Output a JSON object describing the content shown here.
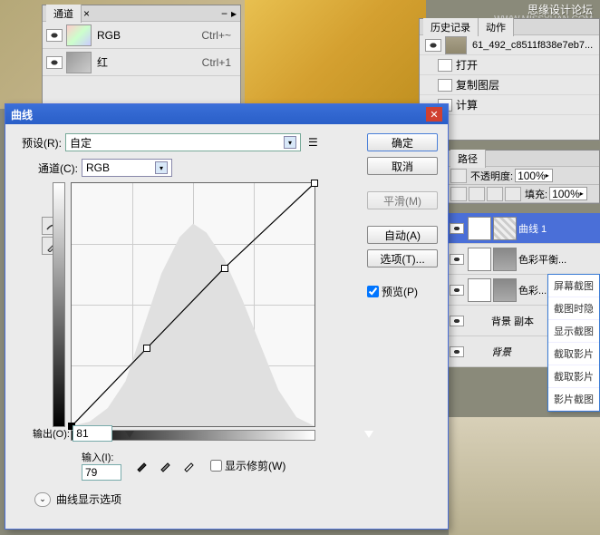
{
  "watermark": {
    "line1": "思缘设计论坛",
    "line2": "WWW.MISSYUAN.COM"
  },
  "channels_panel": {
    "tab": "通道",
    "rows": [
      {
        "name": "RGB",
        "shortcut": "Ctrl+~"
      },
      {
        "name": "红",
        "shortcut": "Ctrl+1"
      }
    ]
  },
  "history_panel": {
    "tabs": [
      "历史记录",
      "动作"
    ],
    "doc_name": "61_492_c8511f838e7eb7...",
    "items": [
      "打开",
      "复制图层",
      "计算"
    ]
  },
  "paths_panel": {
    "tab": "路径",
    "opacity_label": "不透明度:",
    "opacity_value": "100%",
    "fill_label": "填充:",
    "fill_value": "100%"
  },
  "layers": {
    "items": [
      {
        "name": "曲线 1",
        "selected": true
      },
      {
        "name": "色彩平衡..."
      },
      {
        "name": "色彩..."
      },
      {
        "name": "背景 副本"
      },
      {
        "name": "背景"
      }
    ]
  },
  "context_menu": {
    "items": [
      "屏幕截图",
      "截图时隐",
      "显示截图",
      "截取影片",
      "截取影片",
      "影片截图"
    ]
  },
  "curves_dialog": {
    "title": "曲线",
    "preset_label": "预设(R):",
    "preset_value": "自定",
    "channel_label": "通道(C):",
    "channel_value": "RGB",
    "output_label": "输出(O):",
    "output_value": "81",
    "input_label": "输入(I):",
    "input_value": "79",
    "show_clip_label": "显示修剪(W)",
    "options_label": "曲线显示选项",
    "buttons": {
      "ok": "确定",
      "cancel": "取消",
      "smooth": "平滑(M)",
      "auto": "自动(A)",
      "options": "选项(T)...",
      "preview": "预览(P)"
    }
  },
  "chart_data": {
    "type": "line",
    "title": "曲线",
    "xlabel": "输入",
    "ylabel": "输出",
    "xlim": [
      0,
      255
    ],
    "ylim": [
      0,
      255
    ],
    "points": [
      {
        "x": 0,
        "y": 0
      },
      {
        "x": 79,
        "y": 81
      },
      {
        "x": 160,
        "y": 165
      },
      {
        "x": 255,
        "y": 255
      }
    ],
    "grid": true
  }
}
